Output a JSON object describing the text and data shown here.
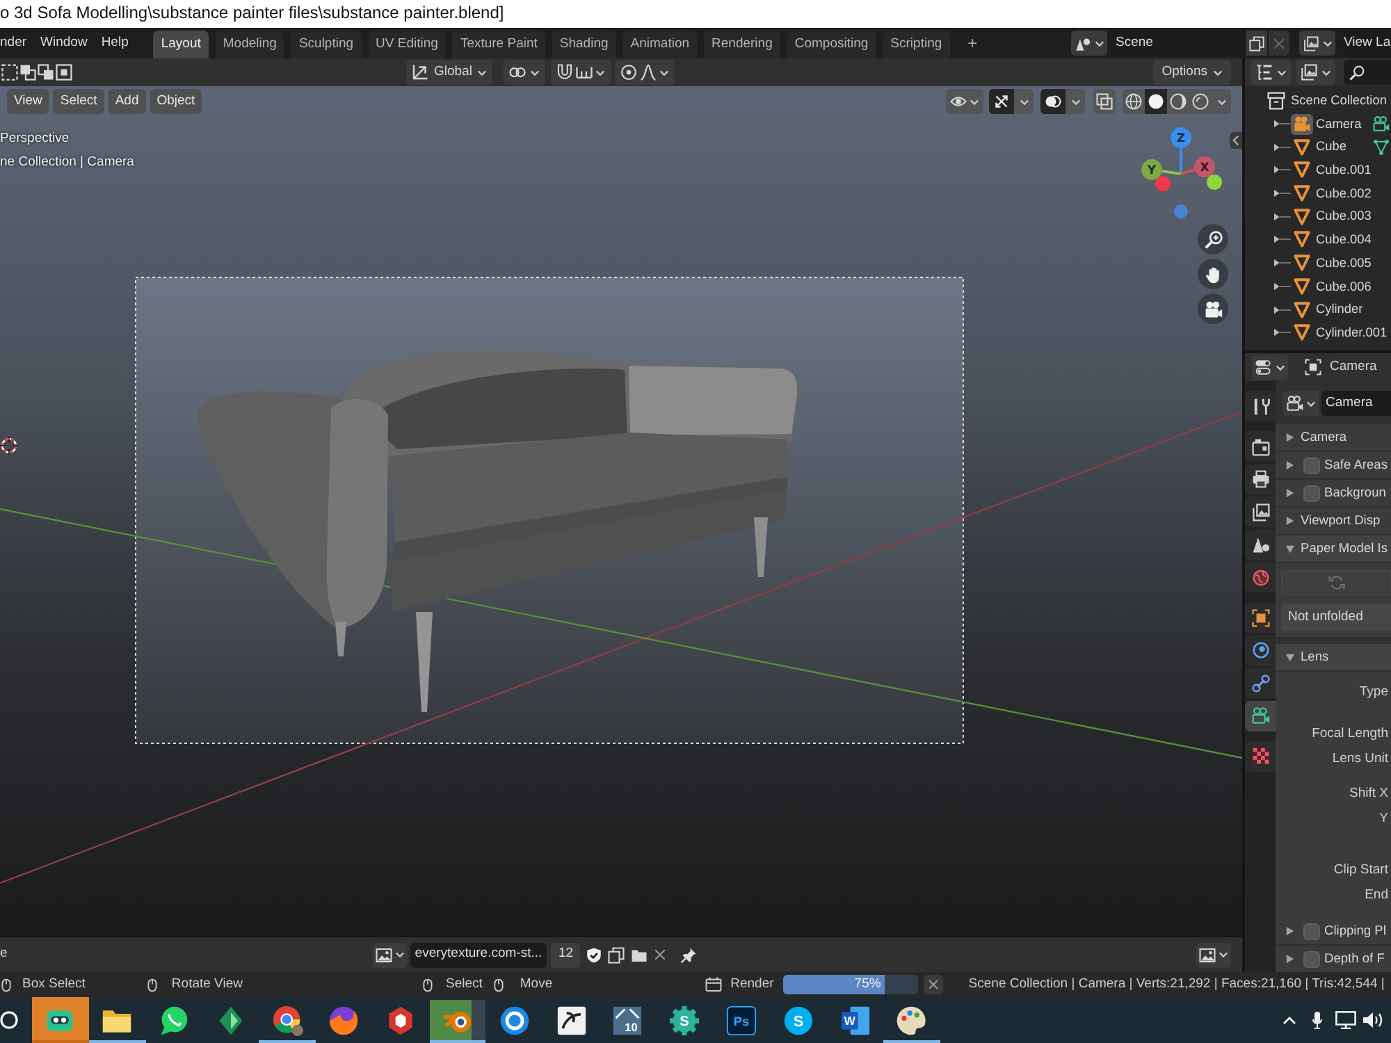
{
  "title_bar": {
    "title": "o 3d Sofa Modelling\\substance painter files\\substance painter.blend]"
  },
  "top_bar": {
    "menus": [
      "nder",
      "Window",
      "Help"
    ],
    "workspaces": [
      {
        "label": "Layout",
        "selected": true
      },
      {
        "label": "Modeling",
        "selected": false
      },
      {
        "label": "Sculpting",
        "selected": false
      },
      {
        "label": "UV Editing",
        "selected": false
      },
      {
        "label": "Texture Paint",
        "selected": false
      },
      {
        "label": "Shading",
        "selected": false
      },
      {
        "label": "Animation",
        "selected": false
      },
      {
        "label": "Rendering",
        "selected": false
      },
      {
        "label": "Compositing",
        "selected": false
      },
      {
        "label": "Scripting",
        "selected": false
      }
    ],
    "add_workspace": "+",
    "scene": "Scene",
    "view_layer": "View La"
  },
  "tool_header": {
    "orientation": "Global",
    "options": "Options"
  },
  "viewport": {
    "menus": [
      "View",
      "Select",
      "Add",
      "Object"
    ],
    "view_name": "Perspective",
    "object_info": "ne Collection | Camera",
    "gizmo": {
      "z": "Z",
      "y": "Y",
      "x": "X"
    },
    "toggles": [
      {
        "kind": "gizmos",
        "on": true
      },
      {
        "kind": "overlays",
        "on": true
      },
      {
        "kind": "xray",
        "on": false
      }
    ],
    "shading": [
      {
        "kind": "wireframe",
        "selected": false
      },
      {
        "kind": "solid",
        "selected": true
      },
      {
        "kind": "material",
        "selected": false
      },
      {
        "kind": "rendered",
        "selected": false
      }
    ]
  },
  "image_editor": {
    "left_label": "e",
    "image": "everytexture.com-st...",
    "users": "12"
  },
  "outliner": {
    "root": "Scene Collection",
    "items": [
      {
        "name": "Camera",
        "kind": "camera",
        "selected": true,
        "expanded": false,
        "data_icon": true
      },
      {
        "name": "Cube",
        "kind": "mesh",
        "selected": false,
        "expanded": false,
        "data_icon": true
      },
      {
        "name": "Cube.001",
        "kind": "mesh",
        "selected": false,
        "expanded": false,
        "data_icon": false
      },
      {
        "name": "Cube.002",
        "kind": "mesh",
        "selected": false,
        "expanded": false,
        "data_icon": false
      },
      {
        "name": "Cube.003",
        "kind": "mesh",
        "selected": false,
        "expanded": false,
        "data_icon": false
      },
      {
        "name": "Cube.004",
        "kind": "mesh",
        "selected": false,
        "expanded": false,
        "data_icon": false
      },
      {
        "name": "Cube.005",
        "kind": "mesh",
        "selected": false,
        "expanded": false,
        "data_icon": false
      },
      {
        "name": "Cube.006",
        "kind": "mesh",
        "selected": false,
        "expanded": false,
        "data_icon": false
      },
      {
        "name": "Cylinder",
        "kind": "mesh",
        "selected": false,
        "expanded": false,
        "data_icon": false
      },
      {
        "name": "Cylinder.001",
        "kind": "mesh",
        "selected": false,
        "expanded": false,
        "data_icon": false
      }
    ]
  },
  "properties": {
    "object": "Camera",
    "tab_groups": [
      [
        {
          "kind": "tool",
          "selected": false
        }
      ],
      [
        {
          "kind": "render",
          "selected": false
        },
        {
          "kind": "output",
          "selected": false
        },
        {
          "kind": "view_layer",
          "selected": false
        },
        {
          "kind": "scene",
          "selected": false
        },
        {
          "kind": "world",
          "selected": false
        }
      ],
      [
        {
          "kind": "object",
          "selected": false
        },
        {
          "kind": "physics",
          "selected": false
        },
        {
          "kind": "constraints",
          "selected": false
        },
        {
          "kind": "data",
          "selected": true
        }
      ],
      [
        {
          "kind": "texture",
          "selected": false
        }
      ]
    ],
    "datablock": "Camera",
    "panels": [
      {
        "kind": "plain",
        "label": "Camera",
        "expanded": false
      },
      {
        "kind": "toggle",
        "label": "Safe Areas",
        "expanded": false,
        "checked": false
      },
      {
        "kind": "toggle",
        "label": "Backgroun",
        "expanded": false,
        "checked": false
      },
      {
        "kind": "plain",
        "label": "Viewport Disp",
        "expanded": false
      },
      {
        "kind": "plain",
        "label": "Paper Model Is",
        "expanded": true,
        "rows": [
          {
            "kind": "refresh",
            "disabled": true
          },
          {
            "kind": "status",
            "text": "Not unfolded"
          }
        ]
      },
      {
        "kind": "plain",
        "label": "Lens",
        "expanded": true,
        "field_groups": [
          [
            "Type"
          ],
          [
            "Focal Length",
            "Lens Unit"
          ],
          [
            "Shift X",
            "Y"
          ],
          [
            "Clip Start",
            "End"
          ]
        ]
      },
      {
        "kind": "toggle",
        "label": "Clipping Pl",
        "expanded": false,
        "checked": false
      },
      {
        "kind": "toggle",
        "label": "Depth of F",
        "expanded": false,
        "checked": false
      }
    ]
  },
  "status_bar": {
    "left_hints": [
      "Box Select",
      "Rotate View"
    ],
    "center_hints": [
      "Select",
      "Move"
    ],
    "job": {
      "label": "Render",
      "level": 0.75,
      "reading": "75%"
    },
    "stats": "Scene Collection | Camera | Verts:21,292 | Faces:21,160 | Tris:42,544 |"
  },
  "taskbar": {
    "apps": [
      {
        "kind": "search",
        "running": false,
        "selected": false,
        "flashing": false
      },
      {
        "kind": "robot",
        "running": false,
        "selected": false,
        "flashing": true
      },
      {
        "kind": "folder",
        "running": true,
        "selected": false,
        "flashing": false
      },
      {
        "kind": "chat",
        "running": false,
        "selected": false,
        "flashing": false
      },
      {
        "kind": "diamond",
        "running": false,
        "selected": false,
        "flashing": false
      },
      {
        "kind": "browser",
        "running": true,
        "selected": false,
        "flashing": false
      },
      {
        "kind": "fox",
        "running": false,
        "selected": false,
        "flashing": false
      },
      {
        "kind": "box_logo",
        "running": false,
        "selected": false,
        "flashing": false
      },
      {
        "kind": "orbit",
        "running": true,
        "selected": true,
        "flashing": false,
        "level": 0.75
      },
      {
        "kind": "aperture",
        "running": false,
        "selected": false,
        "flashing": false
      },
      {
        "kind": "stroke",
        "running": false,
        "selected": false,
        "flashing": false
      },
      {
        "kind": "number_tile",
        "label": "10",
        "running": false,
        "selected": false,
        "flashing": false
      },
      {
        "kind": "gear_badge",
        "label": "S",
        "running": false,
        "selected": false,
        "flashing": false
      },
      {
        "kind": "letter_tile",
        "label": "Ps",
        "running": false,
        "selected": false,
        "flashing": false
      },
      {
        "kind": "letter_circle",
        "label": "S",
        "running": false,
        "selected": false,
        "flashing": false
      },
      {
        "kind": "doc_letter",
        "label": "W",
        "running": false,
        "selected": false,
        "flashing": false
      },
      {
        "kind": "palette",
        "running": true,
        "selected": false,
        "flashing": false
      }
    ]
  }
}
